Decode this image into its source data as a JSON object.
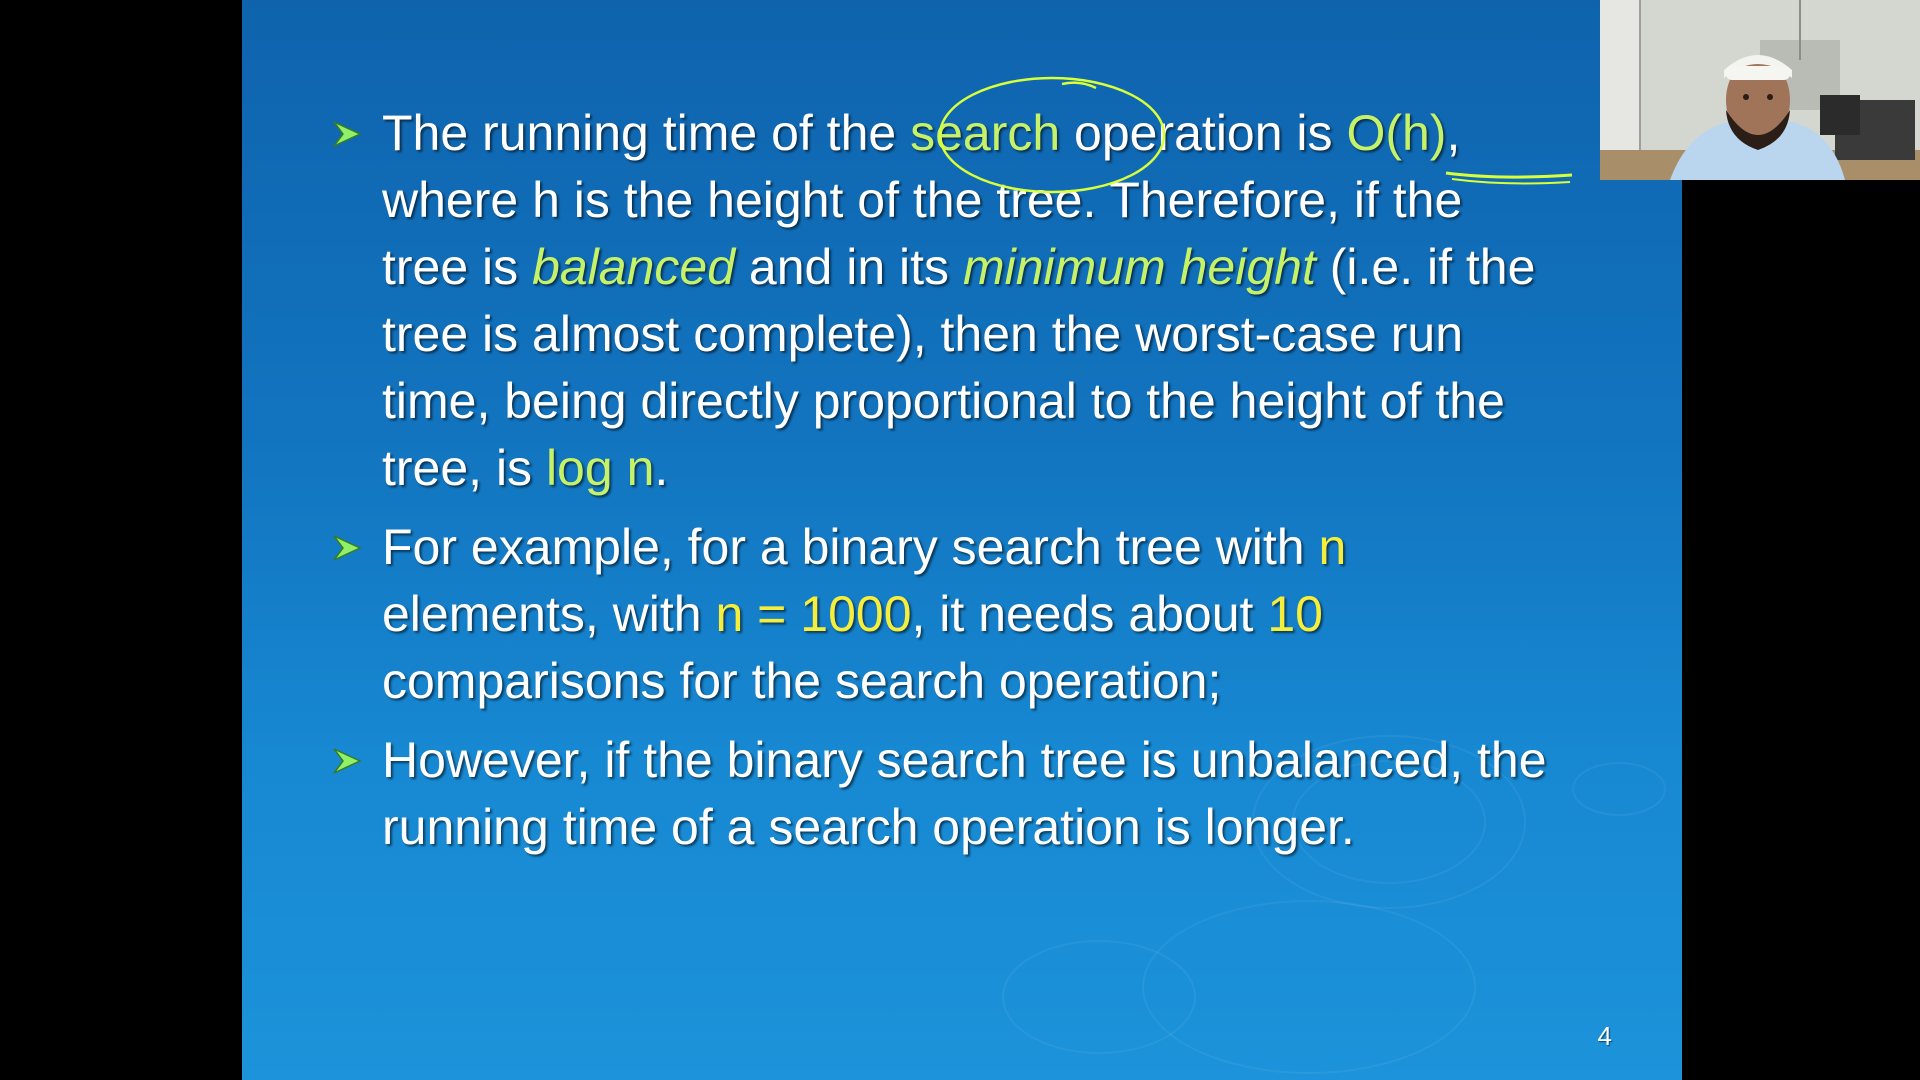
{
  "slide": {
    "page_number": "4",
    "bullets": [
      {
        "segments": [
          {
            "t": "The running time of the "
          },
          {
            "t": "search",
            "style": "green"
          },
          {
            "t": " operation is "
          },
          {
            "t": "O(h)",
            "style": "green"
          },
          {
            "t": ", where h is the height of the tree. Therefore, if the tree is "
          },
          {
            "t": "balanced",
            "style": "em"
          },
          {
            "t": " and in its "
          },
          {
            "t": "minimum height",
            "style": "em"
          },
          {
            "t": " (i.e. if the tree is almost complete), then the worst-case run time, being directly proportional to the height of the tree, is "
          },
          {
            "t": "log n",
            "style": "green"
          },
          {
            "t": "."
          }
        ]
      },
      {
        "segments": [
          {
            "t": "For example, for a binary search tree with "
          },
          {
            "t": "n",
            "style": "yellow"
          },
          {
            "t": " elements, with "
          },
          {
            "t": "n = 1000",
            "style": "yellow"
          },
          {
            "t": ", it needs about "
          },
          {
            "t": "10",
            "style": "yellow"
          },
          {
            "t": " comparisons for the search operation;"
          }
        ]
      },
      {
        "segments": [
          {
            "t": "However, if the binary search tree is unbalanced, the running time of a search operation is longer."
          }
        ]
      }
    ]
  },
  "colors": {
    "slide_bg": "#1274bf",
    "highlight_green": "#c6f26a",
    "highlight_yellow": "#f6ee3d",
    "bullet_arrow": "#8ff06a",
    "annotation_ink": "#d8ff3a"
  },
  "icons": {
    "bullet": "arrow-right-icon"
  }
}
